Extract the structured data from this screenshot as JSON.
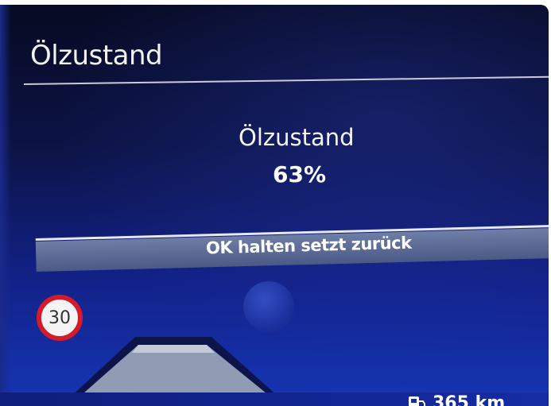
{
  "header": {
    "title": "Ölzustand"
  },
  "info": {
    "label": "Ölzustand",
    "value": "63%",
    "level_percent": 63
  },
  "reset": {
    "hint": "OK halten setzt zurück"
  },
  "speed_limit": {
    "value": "30"
  },
  "status_bar": {
    "range": "365 km"
  },
  "colors": {
    "background": "#0c1345",
    "accent_band": "#5a6a96",
    "speed_sign_ring": "#d41b2c",
    "text": "#ffffff"
  },
  "icons": {
    "fuel": "fuel-pump-icon",
    "vehicle": "road-view-icon"
  }
}
